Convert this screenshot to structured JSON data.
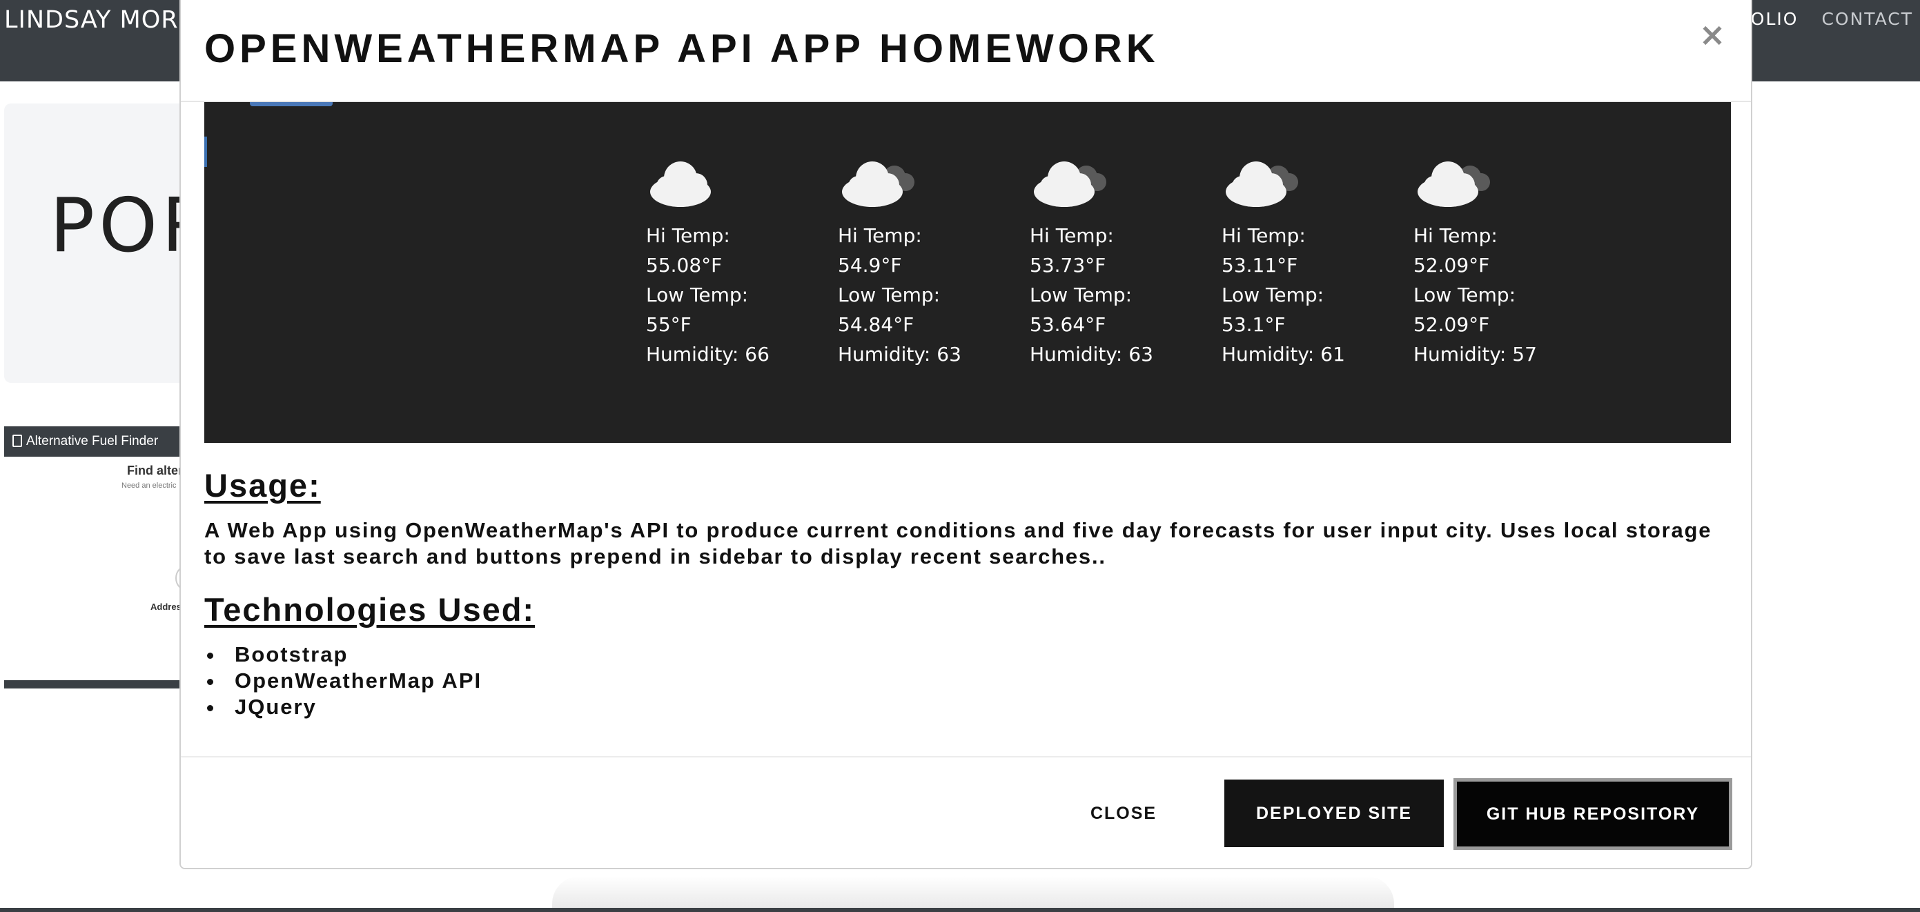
{
  "background": {
    "nav": {
      "brand": "LINDSAY MOR",
      "links": [
        "FOLIO",
        "CONTACT"
      ]
    },
    "jumbotron_title": "POR",
    "thumbnail": {
      "app_name": "Alternative Fuel Finder",
      "heading": "Find alter",
      "subtext": "Need an electric",
      "address_label": "Addres"
    }
  },
  "modal": {
    "title": "OPENWEATHERMAP API APP HOMEWORK",
    "close_x": "×",
    "forecast": [
      {
        "hi_label": "Hi Temp:",
        "hi": "55.08°F",
        "low_label": "Low Temp:",
        "low": "55°F",
        "humidity": "Humidity: 66",
        "icon": "cloud-icon"
      },
      {
        "hi_label": "Hi Temp:",
        "hi": "54.9°F",
        "low_label": "Low Temp:",
        "low": "54.84°F",
        "humidity": "Humidity: 63",
        "icon": "broken-clouds-icon"
      },
      {
        "hi_label": "Hi Temp:",
        "hi": "53.73°F",
        "low_label": "Low Temp:",
        "low": "53.64°F",
        "humidity": "Humidity: 63",
        "icon": "broken-clouds-icon"
      },
      {
        "hi_label": "Hi Temp:",
        "hi": "53.11°F",
        "low_label": "Low Temp:",
        "low": "53.1°F",
        "humidity": "Humidity: 61",
        "icon": "broken-clouds-icon"
      },
      {
        "hi_label": "Hi Temp:",
        "hi": "52.09°F",
        "low_label": "Low Temp:",
        "low": "52.09°F",
        "humidity": "Humidity: 57",
        "icon": "broken-clouds-icon"
      }
    ],
    "usage_heading": "Usage:",
    "usage_text": "A Web App using OpenWeatherMap's API to produce current conditions and five day forecasts for user input city. Uses local storage to save last search and buttons prepend in sidebar to display recent searches..",
    "tech_heading": "Technologies Used:",
    "technologies": [
      "Bootstrap",
      "OpenWeatherMap API",
      "JQuery"
    ],
    "buttons": {
      "close": "CLOSE",
      "deployed": "DEPLOYED SITE",
      "repo": "GIT HUB REPOSITORY"
    }
  },
  "colors": {
    "nav_bg": "#3a3f44",
    "screenshot_bg": "#222222",
    "button_dark": "#141414"
  }
}
